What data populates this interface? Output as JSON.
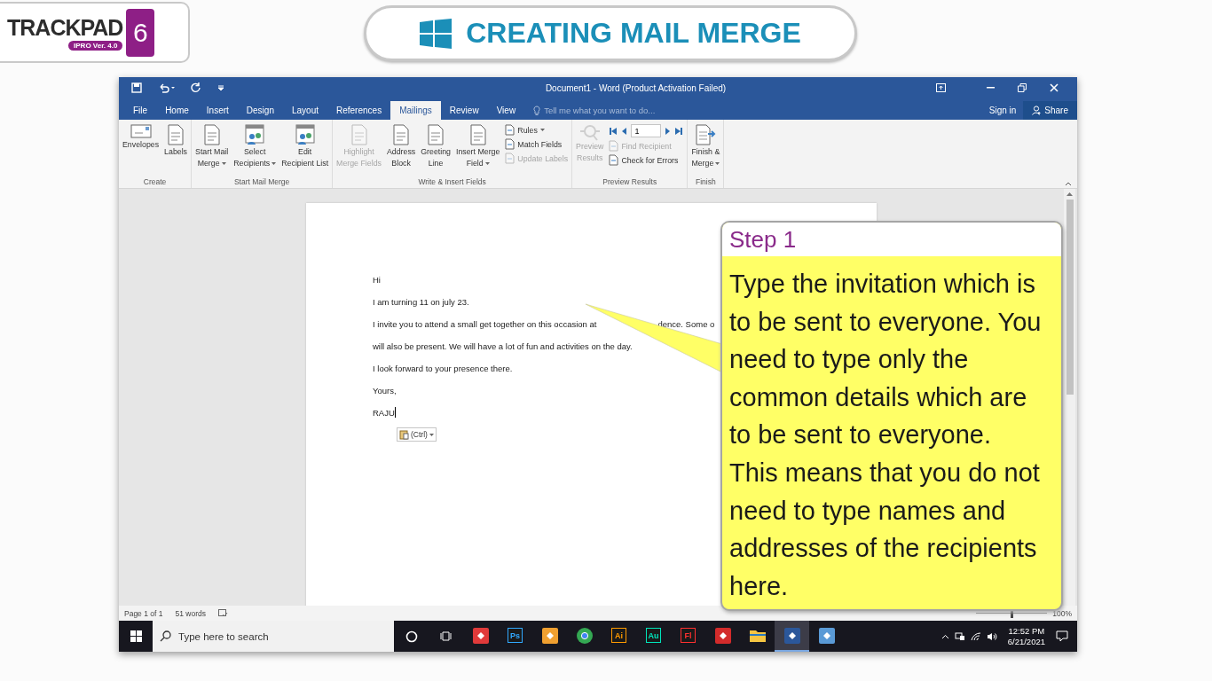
{
  "logo": {
    "name": "TRACKPAD",
    "number": "6",
    "version": "IPRO Ver. 4.0"
  },
  "banner": {
    "title": "CREATING MAIL MERGE"
  },
  "window": {
    "title": "Document1 - Word (Product Activation Failed)"
  },
  "tabs": [
    {
      "label": "File",
      "selected": false
    },
    {
      "label": "Home",
      "selected": false
    },
    {
      "label": "Insert",
      "selected": false
    },
    {
      "label": "Design",
      "selected": false
    },
    {
      "label": "Layout",
      "selected": false
    },
    {
      "label": "References",
      "selected": false
    },
    {
      "label": "Mailings",
      "selected": true
    },
    {
      "label": "Review",
      "selected": false
    },
    {
      "label": "View",
      "selected": false
    }
  ],
  "tell_me": {
    "placeholder": "Tell me what you want to do..."
  },
  "account": {
    "sign_in": "Sign in",
    "share": "Share"
  },
  "ribbon_groups": [
    {
      "label": "Create",
      "items": [
        {
          "kind": "large",
          "lines": [
            "Envelopes"
          ],
          "dropdown": false,
          "disabled": false
        },
        {
          "kind": "large",
          "lines": [
            "Labels"
          ],
          "dropdown": false,
          "disabled": false
        }
      ]
    },
    {
      "label": "Start Mail Merge",
      "items": [
        {
          "kind": "large",
          "lines": [
            "Start Mail",
            "Merge"
          ],
          "dropdown": true,
          "disabled": false
        },
        {
          "kind": "large",
          "lines": [
            "Select",
            "Recipients"
          ],
          "dropdown": true,
          "disabled": false
        },
        {
          "kind": "large",
          "lines": [
            "Edit",
            "Recipient List"
          ],
          "dropdown": false,
          "disabled": false
        }
      ]
    },
    {
      "label": "Write & Insert Fields",
      "items": [
        {
          "kind": "large",
          "lines": [
            "Highlight",
            "Merge Fields"
          ],
          "dropdown": false,
          "disabled": true
        },
        {
          "kind": "large",
          "lines": [
            "Address",
            "Block"
          ],
          "dropdown": false,
          "disabled": false
        },
        {
          "kind": "large",
          "lines": [
            "Greeting",
            "Line"
          ],
          "dropdown": false,
          "disabled": false
        },
        {
          "kind": "large",
          "lines": [
            "Insert Merge",
            "Field"
          ],
          "dropdown": true,
          "disabled": false
        },
        {
          "kind": "small",
          "lines": [
            "Rules"
          ],
          "dropdown": true,
          "disabled": false
        },
        {
          "kind": "small",
          "lines": [
            "Match Fields"
          ],
          "dropdown": false,
          "disabled": false
        },
        {
          "kind": "small",
          "lines": [
            "Update Labels"
          ],
          "dropdown": false,
          "disabled": true
        }
      ]
    },
    {
      "label": "Preview Results",
      "items": [
        {
          "kind": "large",
          "lines": [
            "Preview",
            "Results"
          ],
          "dropdown": false,
          "disabled": true
        },
        {
          "kind": "nav",
          "value": "1"
        },
        {
          "kind": "small",
          "lines": [
            "Find Recipient"
          ],
          "dropdown": false,
          "disabled": true
        },
        {
          "kind": "small",
          "lines": [
            "Check for Errors"
          ],
          "dropdown": false,
          "disabled": false
        }
      ]
    },
    {
      "label": "Finish",
      "items": [
        {
          "kind": "large",
          "lines": [
            "Finish &",
            "Merge"
          ],
          "dropdown": true,
          "disabled": false
        }
      ]
    }
  ],
  "document": {
    "paragraphs": [
      {
        "parts": [
          "Hi"
        ]
      },
      {
        "parts": [
          "I am  turning 11 on july 23."
        ]
      },
      {
        "parts": [
          "I invite you to attend a small get together on this occasion at",
          "dence. Some o"
        ]
      },
      {
        "parts": [
          "will also be present. We will have a lot of fun and activities on the day."
        ]
      },
      {
        "parts": [
          "I look forward to your presence there."
        ]
      },
      {
        "parts": [
          "Yours,"
        ]
      },
      {
        "parts": [
          "RAJU"
        ]
      }
    ],
    "paste_options": "(Ctrl)"
  },
  "callout": {
    "step": "Step 1",
    "text": "Type the invitation which is to be sent to everyone. You need to type only the common details which are to be sent to everyone. This means that you do not need to type names and addresses of the recipients here."
  },
  "status_bar": {
    "page": "Page 1 of 1",
    "words": "51 words",
    "zoom": {
      "level": 0.5,
      "reading": "100%"
    }
  },
  "taskbar": {
    "search": {
      "placeholder": "Type here to search"
    },
    "apps": [
      {
        "kind": "tile",
        "color": "#e03a3a",
        "selected": false
      },
      {
        "kind": "badge",
        "label": "Ps",
        "color": "#31a8ff",
        "selected": false
      },
      {
        "kind": "tile",
        "color": "#f0a030",
        "selected": false
      },
      {
        "kind": "round",
        "color": "#34a853",
        "selected": false
      },
      {
        "kind": "badge",
        "label": "Ai",
        "color": "#ff9a00",
        "selected": false
      },
      {
        "kind": "badge",
        "label": "Au",
        "color": "#00e4bb",
        "selected": false
      },
      {
        "kind": "badge",
        "label": "Fl",
        "color": "#ff3030",
        "selected": false
      },
      {
        "kind": "tile",
        "color": "#d32b2b",
        "selected": false
      },
      {
        "kind": "folder",
        "color": "#f5c542",
        "selected": false
      },
      {
        "kind": "tile",
        "color": "#2b579a",
        "selected": true
      },
      {
        "kind": "tile",
        "color": "#5a9ad6",
        "selected": false
      }
    ],
    "time": "12:52 PM",
    "date": "6/21/2021"
  }
}
